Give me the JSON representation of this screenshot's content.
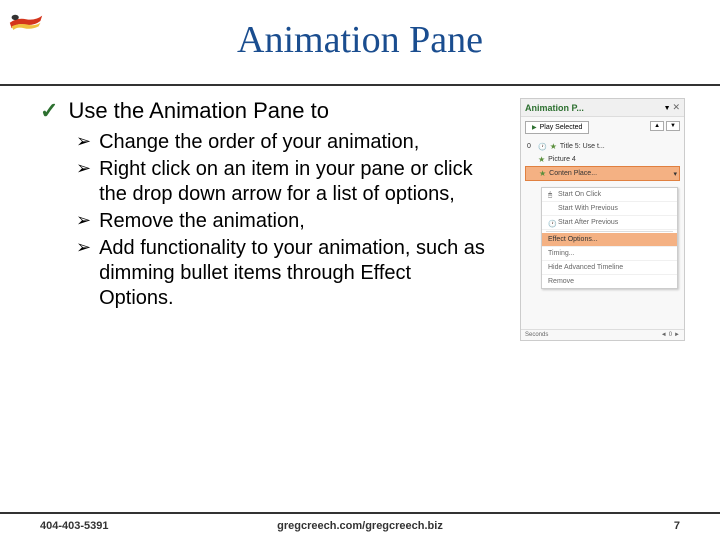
{
  "title": "Animation Pane",
  "mainBullet": "Use the Animation Pane to",
  "subBullets": [
    "Change the order of your animation,",
    "Right click on an item in your pane or click the drop down arrow for a list of options,",
    "Remove the animation,",
    "Add functionality to your animation, such as dimming bullet items through Effect Options."
  ],
  "pane": {
    "title": "Animation P...",
    "playBtn": "Play Selected",
    "items": {
      "num0": "0",
      "title5": "Title 5: Use t...",
      "picture4": "Picture 4",
      "contentPlace": "Conten Place..."
    },
    "context": {
      "startOnClick": "Start On Click",
      "startWithPrevious": "Start With Previous",
      "startAfterPrevious": "Start After Previous",
      "effectOptions": "Effect Options...",
      "timing": "Timing...",
      "hideTimeline": "Hide Advanced Timeline",
      "remove": "Remove"
    },
    "footer": {
      "seconds": "Seconds",
      "zoom": "0"
    }
  },
  "footer": {
    "phone": "404-403-5391",
    "site": "gregcreech.com/gregcreech.biz",
    "page": "7"
  }
}
